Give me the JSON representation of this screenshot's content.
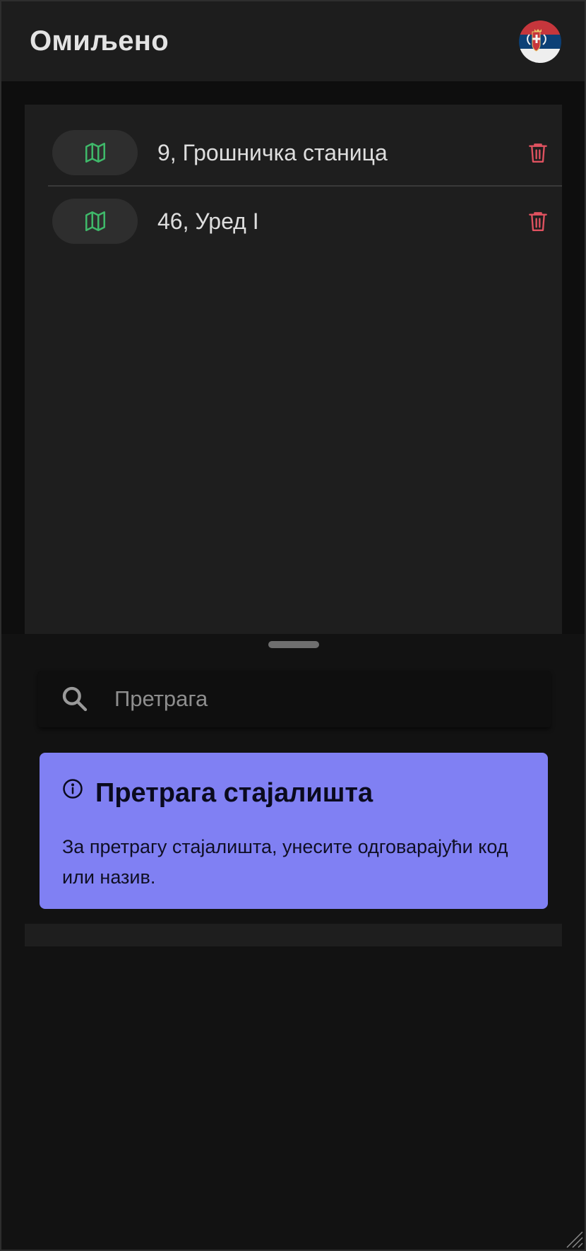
{
  "header": {
    "title": "Омиљено",
    "language_flag_icon": "serbia-flag-icon"
  },
  "favorites": {
    "items": [
      {
        "label": "9, Грошничка станица",
        "map_icon": "map-icon",
        "delete_icon": "trash-icon"
      },
      {
        "label": "46, Уред I",
        "map_icon": "map-icon",
        "delete_icon": "trash-icon"
      }
    ]
  },
  "search": {
    "placeholder": "Претрага",
    "value": "",
    "icon": "search-icon"
  },
  "info_card": {
    "icon": "info-icon",
    "title": "Претрага стајалишта",
    "body": "За претрагу стајалишта, унесите одговарајући код или назив."
  },
  "colors": {
    "background": "#121212",
    "header": "#1d1d1d",
    "panel": "#1e1e1e",
    "accent_green": "#3fb96a",
    "danger_red": "#e05260",
    "info_card": "#8080f3"
  }
}
